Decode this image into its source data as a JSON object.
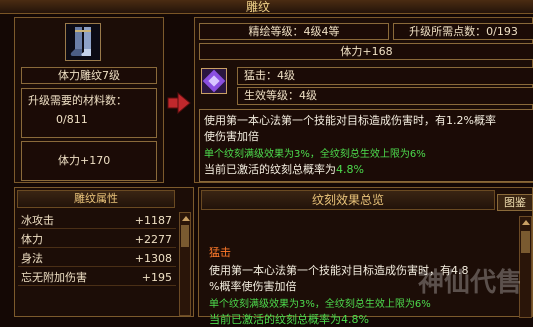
{
  "window": {
    "title": "雕纹"
  },
  "left_panel": {
    "item_name": "体力雕纹7级",
    "material_label": "升级需要的材料数：",
    "material_value": "0/811",
    "stat": "体力+170"
  },
  "right_panel": {
    "level_text": "精绘等级：4级4等",
    "points_text": "升级所需点数：0/193",
    "stat_bar": "体力+168",
    "skill_name": "猛击：4级",
    "effect_level": "生效等级：4级",
    "desc_line1": "使用第一本心法第一个技能对目标造成伤害时，有1.2%概率",
    "desc_line2": "使伤害加倍",
    "green_line": "单个纹刻满级效果为3%，全纹刻总生效上限为6%",
    "activated_label": "当前已激活的纹刻总概率为",
    "activated_value": "4.8%"
  },
  "attributes": {
    "title": "雕纹属性",
    "rows": [
      {
        "name": "冰攻击",
        "value": "+1187"
      },
      {
        "name": "体力",
        "value": "+2277"
      },
      {
        "name": "身法",
        "value": "+1308"
      },
      {
        "name": "忘无附加伤害",
        "value": "+195"
      }
    ]
  },
  "summary": {
    "title": "纹刻效果总览",
    "tab_label": "图鉴",
    "skill_name": "猛击",
    "desc_line1": "使用第一本心法第一个技能对目标造成伤害时，有4.8",
    "desc_line2": "%概率使伤害加倍",
    "green_line": "单个纹刻满级效果为3%，全纹刻总生效上限为6%",
    "activated_partial": "当前已激活的纹刻总概率为4.8%"
  },
  "watermark": "神仙代售",
  "colors": {
    "title_gold": "#e9c37a",
    "green": "#4ddc4d",
    "orange": "#ff7a2a",
    "arrow_red": "#c0282c",
    "gem_purple": "#8a4fe0"
  },
  "icons": {
    "item": "boot-icon",
    "gem": "gem-icon",
    "arrow": "arrow-right-icon"
  }
}
